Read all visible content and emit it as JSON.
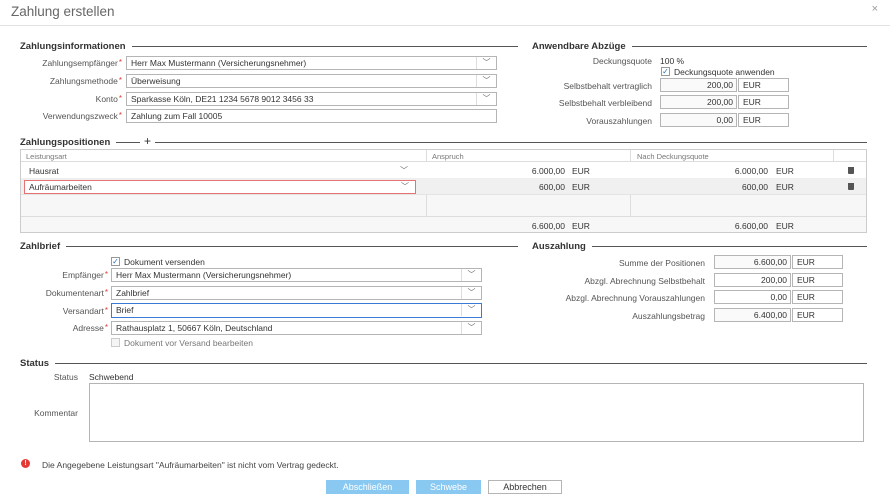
{
  "dialog": {
    "title": "Zahlung erstellen",
    "close_glyph": "×"
  },
  "zahlungsinfo": {
    "section_title": "Zahlungsinformationen",
    "empfaenger_label": "Zahlungsempfänger",
    "empfaenger_value": "Herr Max Mustermann (Versicherungsnehmer)",
    "methode_label": "Zahlungsmethode",
    "methode_value": "Überweisung",
    "konto_label": "Konto",
    "konto_value": "Sparkasse Köln, DE21 1234 5678 9012 3456 33",
    "zweck_label": "Verwendungszweck",
    "zweck_value": "Zahlung zum Fall 10005"
  },
  "abzuege": {
    "section_title": "Anwendbare Abzüge",
    "deckungsquote_label": "Deckungsquote",
    "deckungsquote_value": "100 %",
    "deckungsquote_checkbox": "Deckungsquote anwenden",
    "sb_vertraglich_label": "Selbstbehalt vertraglich",
    "sb_vertraglich_value": "200,00",
    "sb_verbleibend_label": "Selbstbehalt verbleibend",
    "sb_verbleibend_value": "200,00",
    "vorauszahlungen_label": "Vorauszahlungen",
    "vorauszahlungen_value": "0,00",
    "currency": "EUR"
  },
  "positionen": {
    "section_title": "Zahlungspositionen",
    "add_glyph": "+",
    "columns": [
      "Leistungsart",
      "Anspruch",
      "Nach Deckungsquote"
    ],
    "rows": [
      {
        "leistungsart": "Hausrat",
        "anspruch": "6.000,00",
        "nach": "6.000,00"
      },
      {
        "leistungsart": "Aufräumarbeiten",
        "anspruch": "600,00",
        "nach": "600,00"
      }
    ],
    "total_anspruch": "6.600,00",
    "total_nach": "6.600,00",
    "currency": "EUR"
  },
  "zahlbrief": {
    "section_title": "Zahlbrief",
    "versenden_checkbox": "Dokument versenden",
    "empfaenger_label": "Empfänger",
    "empfaenger_value": "Herr Max Mustermann (Versicherungsnehmer)",
    "dokumentenart_label": "Dokumentenart",
    "dokumentenart_value": "Zahlbrief",
    "versandart_label": "Versandart",
    "versandart_value": "Brief",
    "adresse_label": "Adresse",
    "adresse_value": "Rathausplatz 1, 50667 Köln, Deutschland",
    "bearbeiten_checkbox": "Dokument vor Versand bearbeiten"
  },
  "auszahlung": {
    "section_title": "Auszahlung",
    "summe_label": "Summe der Positionen",
    "summe_value": "6.600,00",
    "abzgl_sb_label": "Abzgl. Abrechnung Selbstbehalt",
    "abzgl_sb_value": "200,00",
    "abzgl_vz_label": "Abzgl. Abrechnung Vorauszahlungen",
    "abzgl_vz_value": "0,00",
    "betrag_label": "Auszahlungsbetrag",
    "betrag_value": "6.400,00",
    "currency": "EUR"
  },
  "status": {
    "section_title": "Status",
    "status_label": "Status",
    "status_value": "Schwebend",
    "kommentar_label": "Kommentar"
  },
  "warning": {
    "glyph": "!",
    "text": "Die Angegebene Leistungsart \"Aufräumarbeiten\" ist nicht vom Vertrag gedeckt."
  },
  "buttons": {
    "abschliessen": "Abschließen",
    "schwebe": "Schwebe",
    "abbrechen": "Abbrechen"
  },
  "colors": {
    "primary_button": "#89c9f1",
    "error": "#e53935",
    "error_border": "#e57373",
    "checkbox_accent": "#1e73be",
    "focus_border": "#3a7bd5"
  }
}
